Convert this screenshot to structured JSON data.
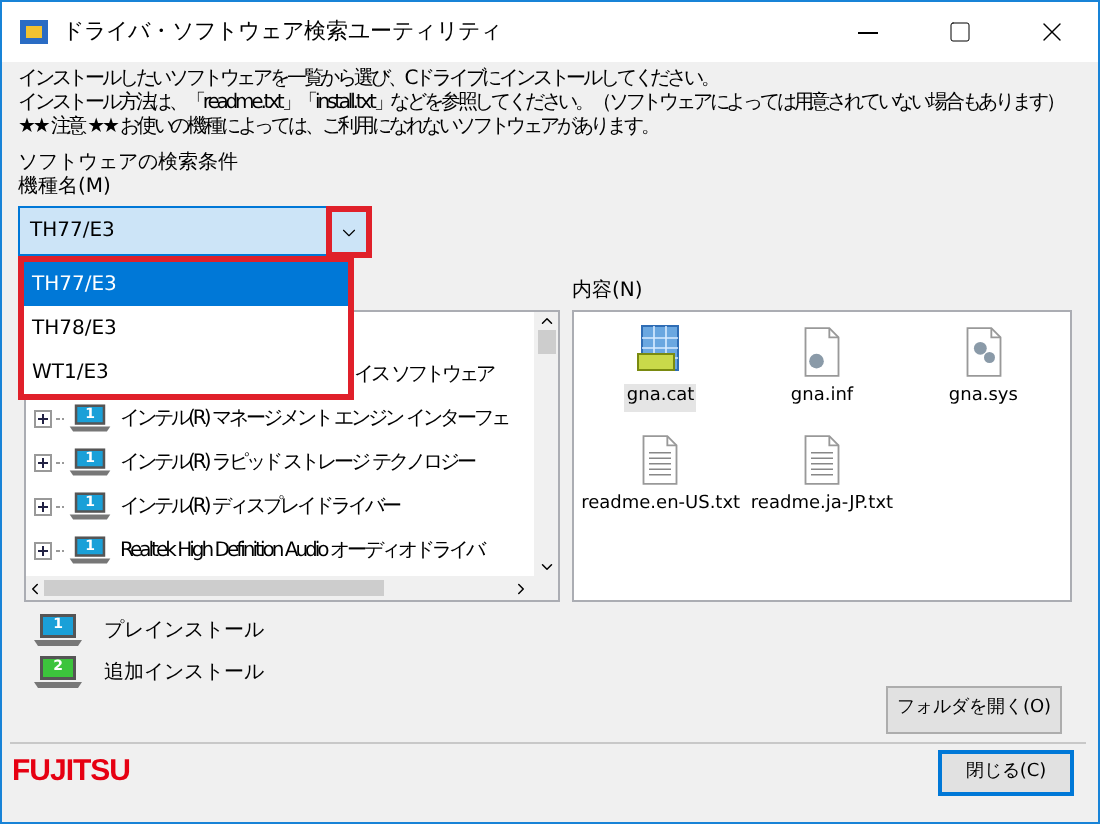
{
  "window": {
    "title": "ドライバ・ソフトウェア検索ユーティリティ"
  },
  "instructions": [
    "インストールしたいソフトウェアを一覧から選び、Cドライブにインストールしてください。",
    "インストール方法は、「readme.txt」「install.txt」などを参照してください。（ソフトウェアによっては用意されていない場合もあります）",
    "★★ 注意 ★★ お使いの機種によっては、ご利用になれないソフトウェアがあります。"
  ],
  "search": {
    "heading": "ソフトウェアの検索条件",
    "label": "機種名(M)",
    "value": "TH77/E3",
    "expanded": true,
    "options": [
      {
        "label": "TH77/E3",
        "selected": true
      },
      {
        "label": "TH78/E3",
        "selected": false
      },
      {
        "label": "WT1/E3",
        "selected": false
      }
    ]
  },
  "tree": {
    "items": [
      {
        "kind": "partial",
        "label": "イス ソフトウェア"
      },
      {
        "kind": "full",
        "label": "インテル(R) マネージメント エンジン インターフェ",
        "expanded": false,
        "badge": "1"
      },
      {
        "kind": "full",
        "label": "インテル(R) ラピッド ストレージ テクノロジー",
        "expanded": false,
        "badge": "1"
      },
      {
        "kind": "full",
        "label": "インテル(R) ディスプレイドライバー",
        "expanded": false,
        "badge": "1"
      },
      {
        "kind": "full",
        "label": "Realtek High Definition Audio オーディオドライバ",
        "expanded": false,
        "badge": "1"
      }
    ]
  },
  "contents": {
    "label": "内容(N)",
    "files": [
      {
        "name": "gna.cat",
        "kind": "catalog",
        "selected": true
      },
      {
        "name": "gna.inf",
        "kind": "setup",
        "selected": false
      },
      {
        "name": "gna.sys",
        "kind": "system",
        "selected": false
      },
      {
        "name": "readme.en-US.txt",
        "kind": "text",
        "selected": false
      },
      {
        "name": "readme.ja-JP.txt",
        "kind": "text",
        "selected": false
      }
    ]
  },
  "legend": [
    {
      "badge": "1",
      "label": "プレインストール",
      "color": "#1aa0d8"
    },
    {
      "badge": "2",
      "label": "追加インストール",
      "color": "#3cc43c"
    }
  ],
  "open_folder_button": "フォルダを開く(O)",
  "brand": "FUJITSU",
  "close_button": "閉じる(C)"
}
